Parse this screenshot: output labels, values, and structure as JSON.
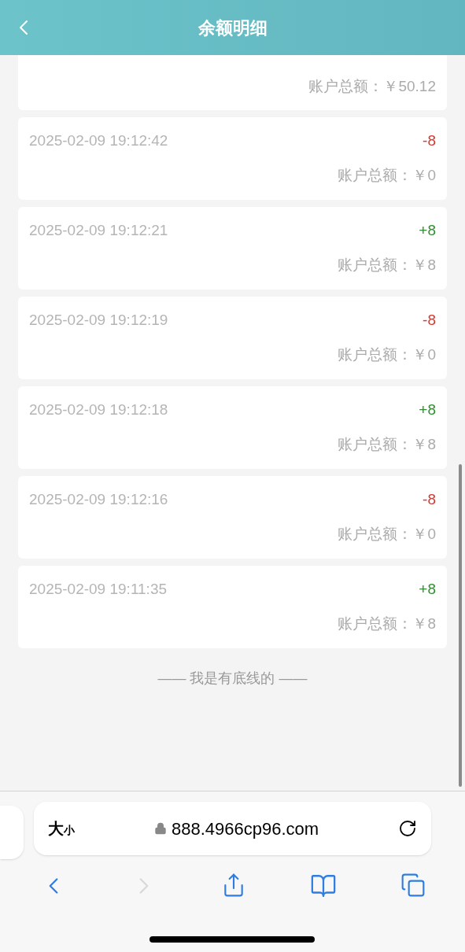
{
  "header": {
    "title": "余额明细"
  },
  "partial_entry": {
    "balance": "账户总额：￥50.12"
  },
  "entries": [
    {
      "time": "2025-02-09 19:12:42",
      "amount": "-8",
      "kind": "debit",
      "balance": "账户总额：￥0"
    },
    {
      "time": "2025-02-09 19:12:21",
      "amount": "+8",
      "kind": "credit",
      "balance": "账户总额：￥8"
    },
    {
      "time": "2025-02-09 19:12:19",
      "amount": "-8",
      "kind": "debit",
      "balance": "账户总额：￥0"
    },
    {
      "time": "2025-02-09 19:12:18",
      "amount": "+8",
      "kind": "credit",
      "balance": "账户总额：￥8"
    },
    {
      "time": "2025-02-09 19:12:16",
      "amount": "-8",
      "kind": "debit",
      "balance": "账户总额：￥0"
    },
    {
      "time": "2025-02-09 19:11:35",
      "amount": "+8",
      "kind": "credit",
      "balance": "账户总额：￥8"
    }
  ],
  "end_note": "—— 我是有底线的 ——",
  "browser": {
    "text_size": {
      "large": "大",
      "small": "小"
    },
    "url": "888.4966cp96.com",
    "forward_disabled": true
  }
}
